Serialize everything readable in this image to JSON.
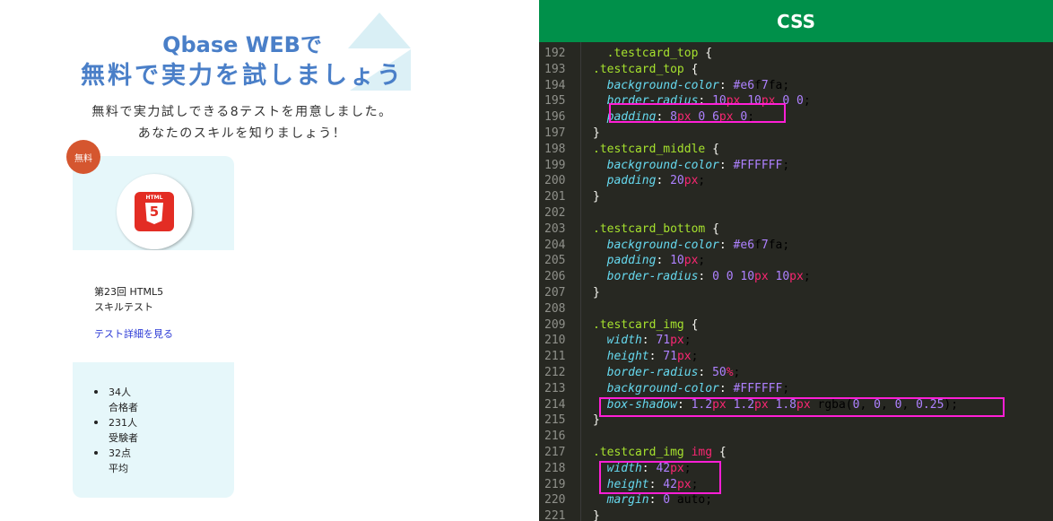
{
  "preview": {
    "heading_line1": "Qbase WEBで",
    "heading_line2": "無料で実力を試しましょう",
    "subtitle_line1": "無料で実力試しできる8テストを用意しました。",
    "subtitle_line2": "あなたのスキルを知りましょう！",
    "card": {
      "badge": "無料",
      "icon": "html5-icon",
      "icon_label": "HTML",
      "icon_digit": "5",
      "title_line1": "第23回 HTML5",
      "title_line2": "スキルテスト",
      "link_text": "テスト詳細を見る",
      "stats": [
        {
          "value": "34人",
          "label": "合格者"
        },
        {
          "value": "231人",
          "label": "受験者"
        },
        {
          "value": "32点",
          "label": "平均"
        }
      ]
    }
  },
  "editor": {
    "header": "CSS",
    "lines": [
      {
        "no": "192",
        "code": "  .testcard_top {"
      },
      {
        "no": "193",
        "code": ".testcard_top {"
      },
      {
        "no": "194",
        "code": "  background-color: #e6f7fa;"
      },
      {
        "no": "195",
        "code": "  border-radius: 10px 10px 0 0;"
      },
      {
        "no": "196",
        "code": "  padding: 8px 0 6px 0;"
      },
      {
        "no": "197",
        "code": "}"
      },
      {
        "no": "198",
        "code": ".testcard_middle {"
      },
      {
        "no": "199",
        "code": "  background-color: #FFFFFF;"
      },
      {
        "no": "200",
        "code": "  padding: 20px;"
      },
      {
        "no": "201",
        "code": "}"
      },
      {
        "no": "202",
        "code": ""
      },
      {
        "no": "203",
        "code": ".testcard_bottom {"
      },
      {
        "no": "204",
        "code": "  background-color: #e6f7fa;"
      },
      {
        "no": "205",
        "code": "  padding: 10px;"
      },
      {
        "no": "206",
        "code": "  border-radius: 0 0 10px 10px;"
      },
      {
        "no": "207",
        "code": "}"
      },
      {
        "no": "208",
        "code": ""
      },
      {
        "no": "209",
        "code": ".testcard_img {"
      },
      {
        "no": "210",
        "code": "  width: 71px;"
      },
      {
        "no": "211",
        "code": "  height: 71px;"
      },
      {
        "no": "212",
        "code": "  border-radius: 50%;"
      },
      {
        "no": "213",
        "code": "  background-color: #FFFFFF;"
      },
      {
        "no": "214",
        "code": "  box-shadow: 1.2px 1.2px 1.8px rgba(0, 0, 0, 0.25);"
      },
      {
        "no": "215",
        "code": "}"
      },
      {
        "no": "216",
        "code": ""
      },
      {
        "no": "217",
        "code": ".testcard_img img {"
      },
      {
        "no": "218",
        "code": "  width: 42px;"
      },
      {
        "no": "219",
        "code": "  height: 42px;"
      },
      {
        "no": "220",
        "code": "  margin: 0 auto;"
      },
      {
        "no": "221",
        "code": "}"
      }
    ],
    "highlight_color": "#ff1fd6"
  },
  "colors": {
    "heading": "#4a7fc8",
    "card_bg": "#e6f7fa",
    "badge": "#d5562f",
    "editor_header": "#00904a",
    "editor_bg": "#272822"
  }
}
